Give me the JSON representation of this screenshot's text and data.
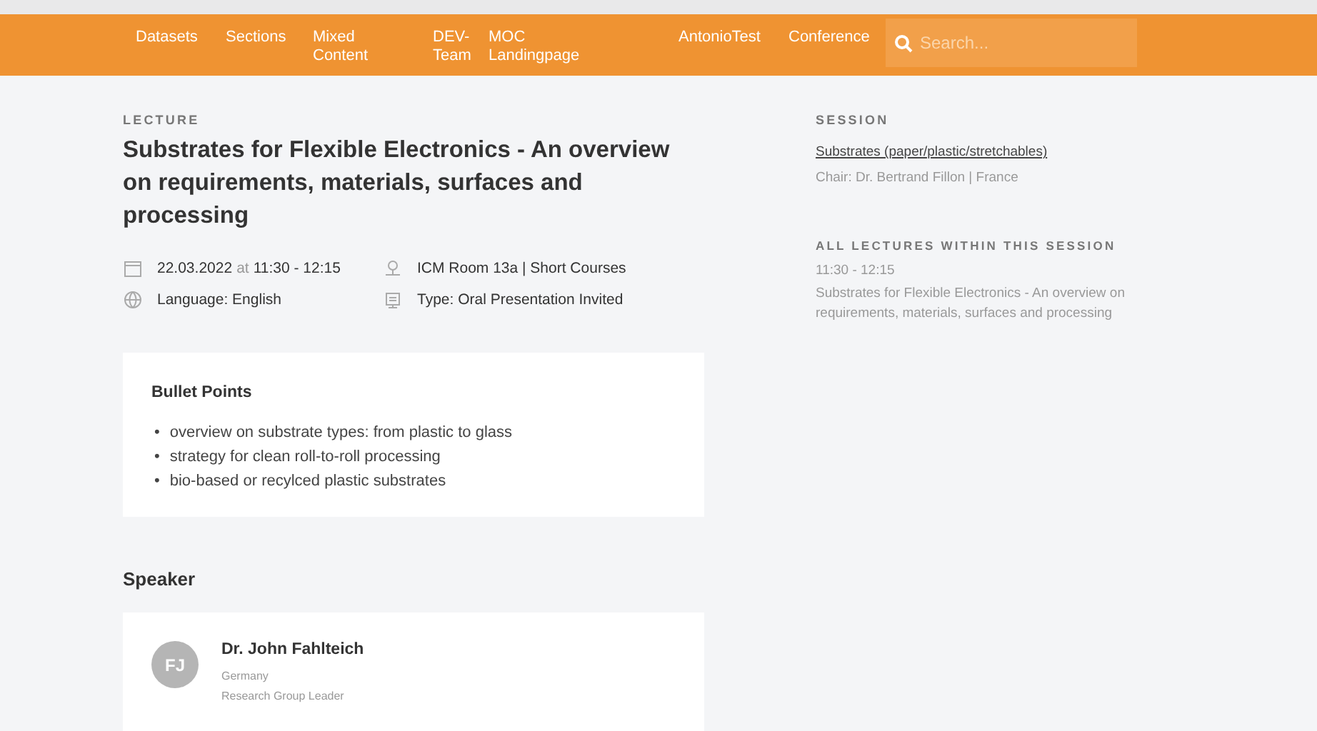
{
  "nav": {
    "items": [
      {
        "label": "Datasets"
      },
      {
        "label": "Sections"
      },
      {
        "label": "Mixed Content"
      },
      {
        "label": "DEV-Team"
      },
      {
        "label": "MOC Landingpage"
      },
      {
        "label": "AntonioTest"
      },
      {
        "label": "Conference"
      }
    ],
    "search": {
      "placeholder": "Search..."
    }
  },
  "lecture": {
    "eyebrow": "LECTURE",
    "title": "Substrates for Flexible Electronics - An overview on requirements, materials, surfaces and processing",
    "meta": [
      {
        "kind": "date",
        "date": "22.03.2022",
        "joiner": "at",
        "time": "11:30 - 12:15"
      },
      {
        "kind": "location",
        "text": "ICM Room 13a | Short Courses"
      },
      {
        "kind": "language",
        "text": "Language: English"
      },
      {
        "kind": "type",
        "text": "Type: Oral Presentation Invited"
      }
    ]
  },
  "bullets": {
    "title": "Bullet Points",
    "items": [
      {
        "marker": "•",
        "text": "overview on substrate types: from plastic to glass"
      },
      {
        "marker": "•",
        "text": "strategy for clean roll-to-roll processing"
      },
      {
        "marker": "•",
        "text": "bio-based or recylced plastic substrates"
      }
    ]
  },
  "speaker": {
    "heading": "Speaker",
    "initials": "FJ",
    "name": "Dr. John Fahlteich",
    "lines": [
      "Germany",
      "Research Group Leader"
    ]
  },
  "session": {
    "eyebrow": "SESSION",
    "link": "Substrates (paper/plastic/stretchables)",
    "chair": "Chair: Dr. Bertrand Fillon | France",
    "lectures_heading": "ALL LECTURES WITHIN THIS SESSION",
    "lectures": [
      {
        "time": "11:30 - 12:15",
        "title": "Substrates for Flexible Electronics - An overview on requirements, materials, surfaces and processing"
      }
    ]
  }
}
